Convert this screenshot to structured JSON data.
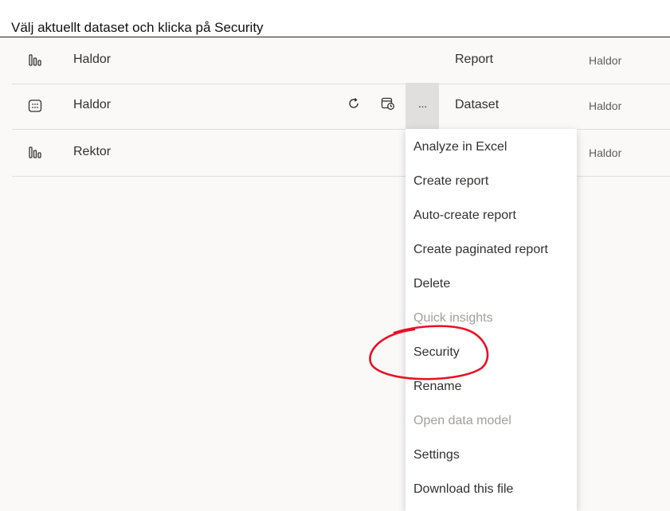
{
  "caption": "Välj aktuellt dataset och klicka på Security",
  "rows": [
    {
      "icon": "report-icon",
      "name": "Haldor",
      "type": "Report",
      "owner": "Haldor"
    },
    {
      "icon": "dataset-icon",
      "name": "Haldor",
      "type": "Dataset",
      "owner": "Haldor"
    },
    {
      "icon": "report-icon",
      "name": "Rektor",
      "type": "",
      "owner": "Haldor"
    }
  ],
  "row_actions": {
    "refresh_icon": "refresh-icon",
    "schedule_icon": "schedule-refresh-icon",
    "more_icon": "more-options-icon",
    "more_label": "···"
  },
  "menu": {
    "items": [
      {
        "label": "Analyze in Excel",
        "disabled": false
      },
      {
        "label": "Create report",
        "disabled": false
      },
      {
        "label": "Auto-create report",
        "disabled": false
      },
      {
        "label": "Create paginated report",
        "disabled": false
      },
      {
        "label": "Delete",
        "disabled": false
      },
      {
        "label": "Quick insights",
        "disabled": true
      },
      {
        "label": "Security",
        "disabled": false
      },
      {
        "label": "Rename",
        "disabled": false
      },
      {
        "label": "Open data model",
        "disabled": true
      },
      {
        "label": "Settings",
        "disabled": false
      },
      {
        "label": "Download this file",
        "disabled": false
      }
    ]
  },
  "annotation": {
    "shape": "hand-drawn-circle",
    "target": "Security",
    "color": "#e81123"
  },
  "colors": {
    "disabled_text": "#a19f9d",
    "hover_bg": "#e1dfdd",
    "text": "#323130"
  }
}
